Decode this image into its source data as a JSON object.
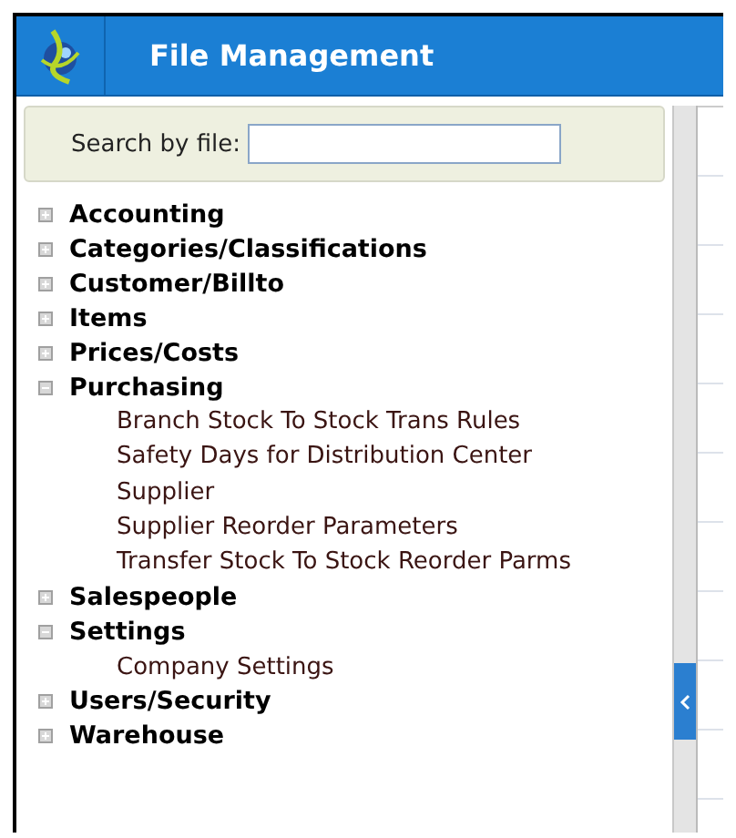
{
  "header": {
    "title": "File Management"
  },
  "search": {
    "label": "Search by file:"
  },
  "tree": [
    {
      "label": "Accounting",
      "expanded": false
    },
    {
      "label": "Categories/Classifications",
      "expanded": false
    },
    {
      "label": "Customer/Billto",
      "expanded": false
    },
    {
      "label": "Items",
      "expanded": false
    },
    {
      "label": "Prices/Costs",
      "expanded": false
    },
    {
      "label": "Purchasing",
      "expanded": true,
      "children": [
        {
          "label": "Branch Stock To Stock Trans Rules"
        },
        {
          "label": "Safety Days for Distribution Center"
        },
        {
          "label": "Supplier"
        },
        {
          "label": "Supplier Reorder Parameters"
        },
        {
          "label": "Transfer Stock To Stock Reorder Parms"
        }
      ]
    },
    {
      "label": "Salespeople",
      "expanded": false
    },
    {
      "label": "Settings",
      "expanded": true,
      "children": [
        {
          "label": "Company Settings"
        }
      ]
    },
    {
      "label": "Users/Security",
      "expanded": false
    },
    {
      "label": "Warehouse",
      "expanded": false
    }
  ]
}
